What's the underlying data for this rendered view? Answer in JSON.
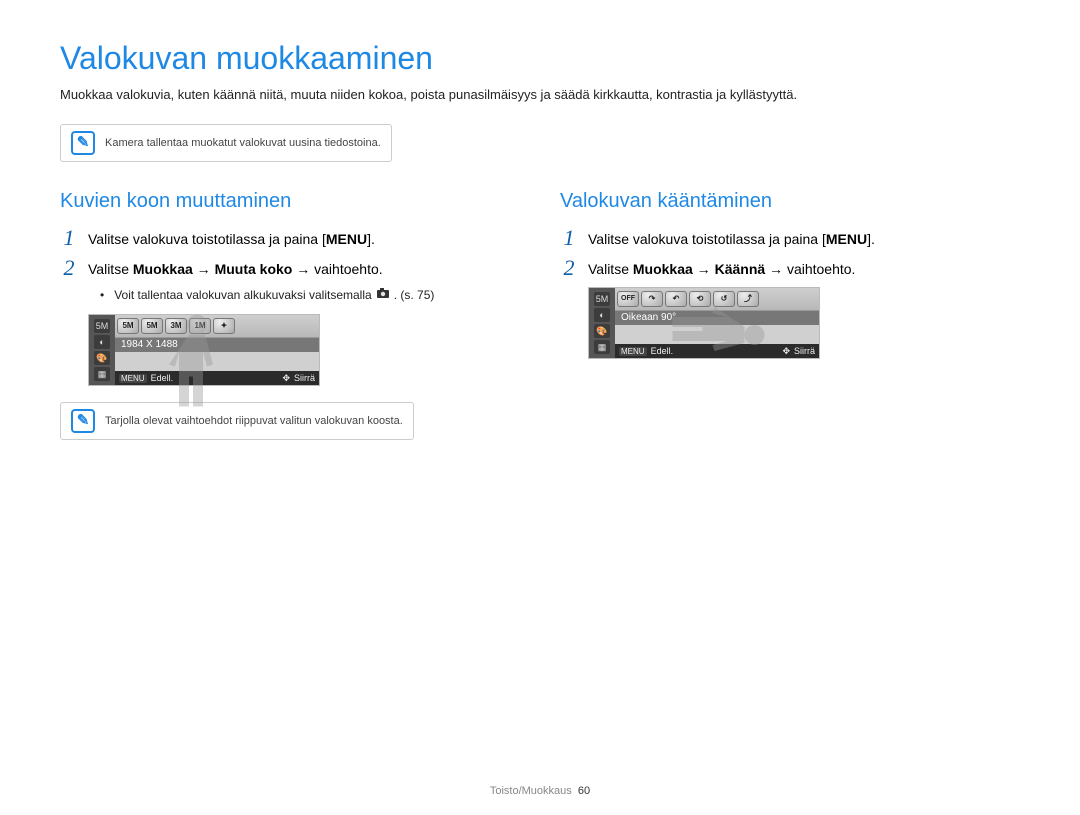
{
  "title": "Valokuvan muokkaaminen",
  "intro": "Muokkaa valokuvia, kuten käännä niitä, muuta niiden kokoa, poista punasilmäisyys ja säädä kirkkautta, kontrastia ja kyllästyyttä.",
  "note1": "Kamera tallentaa muokatut valokuvat uusina tiedostoina.",
  "left": {
    "heading": "Kuvien koon muuttaminen",
    "step1_prefix": "Valitse valokuva toistotilassa ja paina [",
    "step1_button": "MENU",
    "step1_suffix": "].",
    "step2_prefix": "Valitse ",
    "step2_b1": "Muokkaa",
    "step2_arrow1": " → ",
    "step2_b2": "Muuta koko",
    "step2_arrow2": " → ",
    "step2_tail": "vaihtoehto.",
    "bullet_prefix": "Voit tallentaa valokuvan alkukuvaksi valitsemalla ",
    "bullet_icon_name": "start-image-icon",
    "bullet_suffix": ". (s. 75)",
    "cam": {
      "toolbar": [
        "5M",
        "5M",
        "3M",
        "1M",
        "✦"
      ],
      "label": "1984 X 1488",
      "footer_menu": "MENU",
      "footer_left": "Edell.",
      "footer_move_icon": "✥",
      "footer_right": "Siirrä"
    },
    "note2": "Tarjolla olevat vaihtoehdot riippuvat valitun valokuvan koosta."
  },
  "right": {
    "heading": "Valokuvan kääntäminen",
    "step1_prefix": "Valitse valokuva toistotilassa ja paina [",
    "step1_button": "MENU",
    "step1_suffix": "].",
    "step2_prefix": "Valitse ",
    "step2_b1": "Muokkaa",
    "step2_arrow1": " → ",
    "step2_b2": "Käännä",
    "step2_arrow2": " → ",
    "step2_tail": "vaihtoehto.",
    "cam": {
      "toolbar": [
        "OFF",
        "↷",
        "↶",
        "⟲",
        "↺",
        "⤴"
      ],
      "label": "Oikeaan 90°",
      "footer_menu": "MENU",
      "footer_left": "Edell.",
      "footer_move_icon": "✥",
      "footer_right": "Siirrä"
    }
  },
  "footer_section": "Toisto/Muokkaus",
  "footer_page": "60"
}
